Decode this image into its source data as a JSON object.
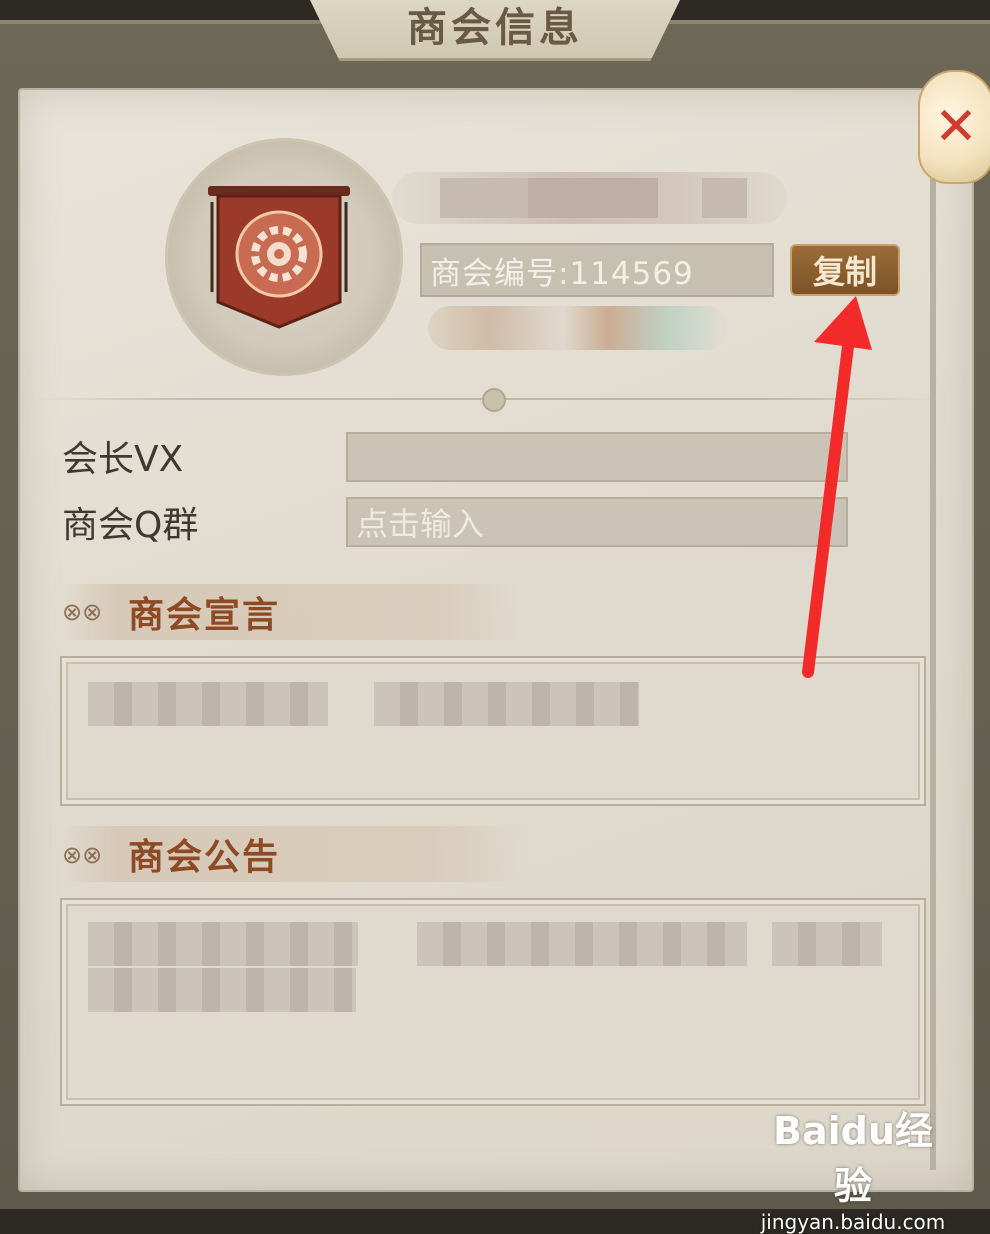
{
  "window": {
    "title": "商会信息"
  },
  "header": {
    "close_icon": "close-x-icon",
    "guild_id_label": "商会编号:114569",
    "copy_label": "复制"
  },
  "form": {
    "leader_vx_label": "会长VX",
    "leader_vx_value": "",
    "qq_group_label": "商会Q群",
    "qq_group_placeholder": "点击输入"
  },
  "sections": {
    "declaration_title": "商会宣言",
    "announcement_title": "商会公告"
  },
  "watermark": {
    "brand": "Baidu经验",
    "url": "jingyan.baidu.com"
  },
  "colors": {
    "accent_title": "#8e4a24",
    "copy_button": "#8a5c2c",
    "annotation_arrow": "#f22a2a"
  }
}
